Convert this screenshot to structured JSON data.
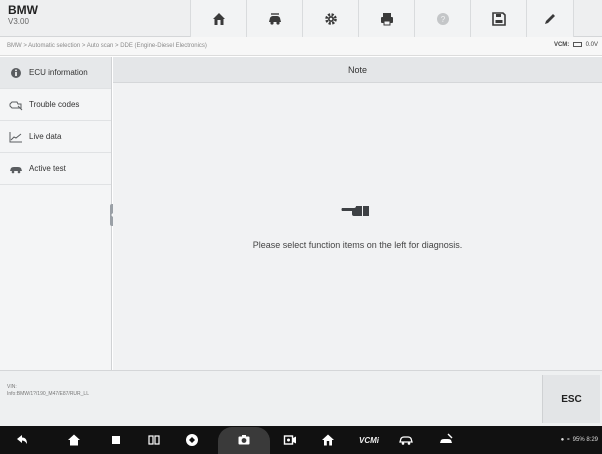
{
  "app": {
    "name": "BMW",
    "version": "V3.00"
  },
  "toolbar": {
    "buttons": [
      {
        "name": "home-icon"
      },
      {
        "name": "car-swap-icon"
      },
      {
        "name": "settings-gear-icon"
      },
      {
        "name": "print-icon"
      },
      {
        "name": "help-icon"
      },
      {
        "name": "save-icon"
      },
      {
        "name": "edit-pencil-icon"
      }
    ]
  },
  "breadcrumb": {
    "path": "BMW > Automatic selection > Auto scan > DDE (Engine-Diesel Electronics)"
  },
  "vcm_status": {
    "label": "VCM:",
    "value": "0.0V"
  },
  "sidebar": {
    "items": [
      {
        "label": "ECU information",
        "icon": "info-icon"
      },
      {
        "label": "Trouble codes",
        "icon": "engine-trouble-icon"
      },
      {
        "label": "Live data",
        "icon": "line-chart-icon"
      },
      {
        "label": "Active test",
        "icon": "car-test-icon"
      }
    ]
  },
  "main": {
    "header": "Note",
    "message": "Please select function items on the left for diagnosis.",
    "icon": "pointing-hand-icon"
  },
  "info": {
    "vin_label": "VIN:",
    "info_line": "Info:BMW/1?/190_M47/E87/RUR_LL"
  },
  "esc_label": "ESC",
  "navbar": {
    "vcm_label": "VCMi",
    "status": "95% 8:29"
  },
  "colors": {
    "header_bg": "#eeeff0",
    "sidebar_bg": "#f4f5f6",
    "content_bg": "#f1f2f3",
    "navbar_bg": "#111111"
  }
}
